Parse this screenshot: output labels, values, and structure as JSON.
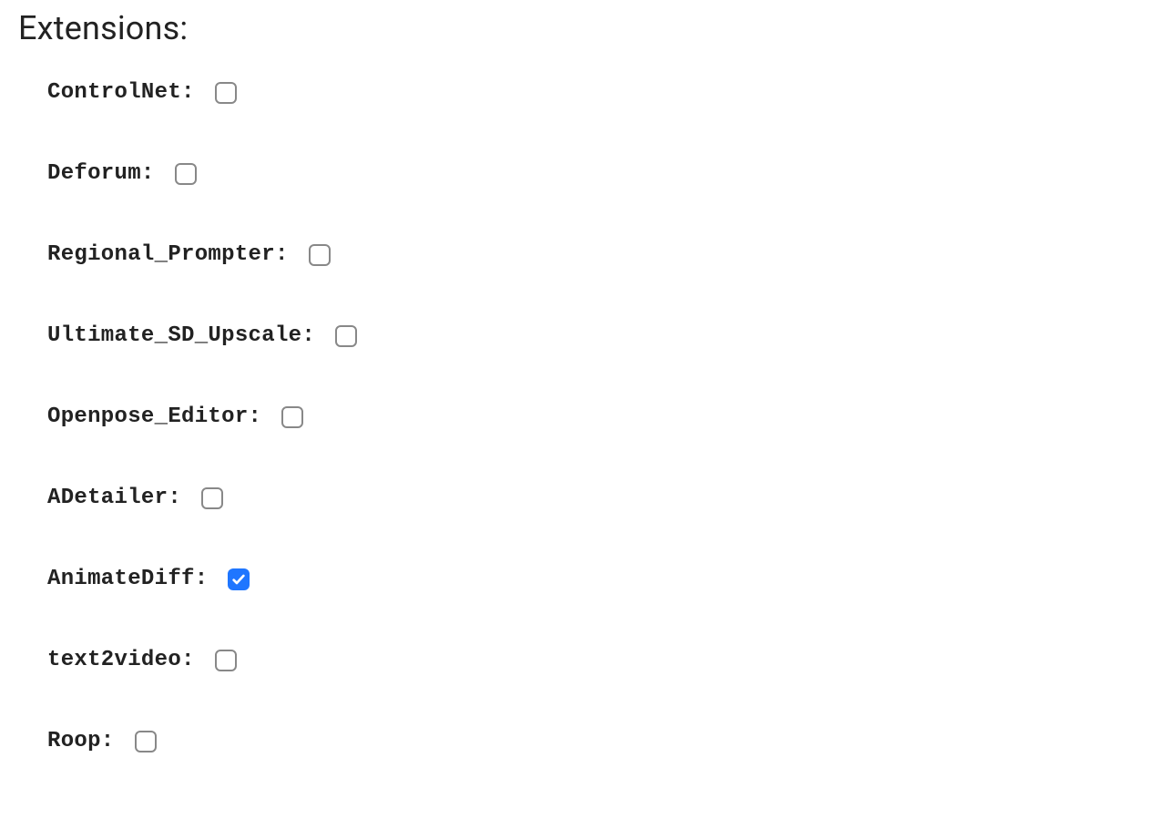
{
  "section_title": "Extensions:",
  "extensions": [
    {
      "name": "ControlNet",
      "label": "ControlNet:",
      "checked": false
    },
    {
      "name": "Deforum",
      "label": "Deforum:",
      "checked": false
    },
    {
      "name": "Regional_Prompter",
      "label": "Regional_Prompter:",
      "checked": false
    },
    {
      "name": "Ultimate_SD_Upscale",
      "label": "Ultimate_SD_Upscale:",
      "checked": false
    },
    {
      "name": "Openpose_Editor",
      "label": "Openpose_Editor:",
      "checked": false
    },
    {
      "name": "ADetailer",
      "label": "ADetailer:",
      "checked": false
    },
    {
      "name": "AnimateDiff",
      "label": "AnimateDiff:",
      "checked": true
    },
    {
      "name": "text2video",
      "label": "text2video:",
      "checked": false
    },
    {
      "name": "Roop",
      "label": "Roop:",
      "checked": false
    }
  ]
}
